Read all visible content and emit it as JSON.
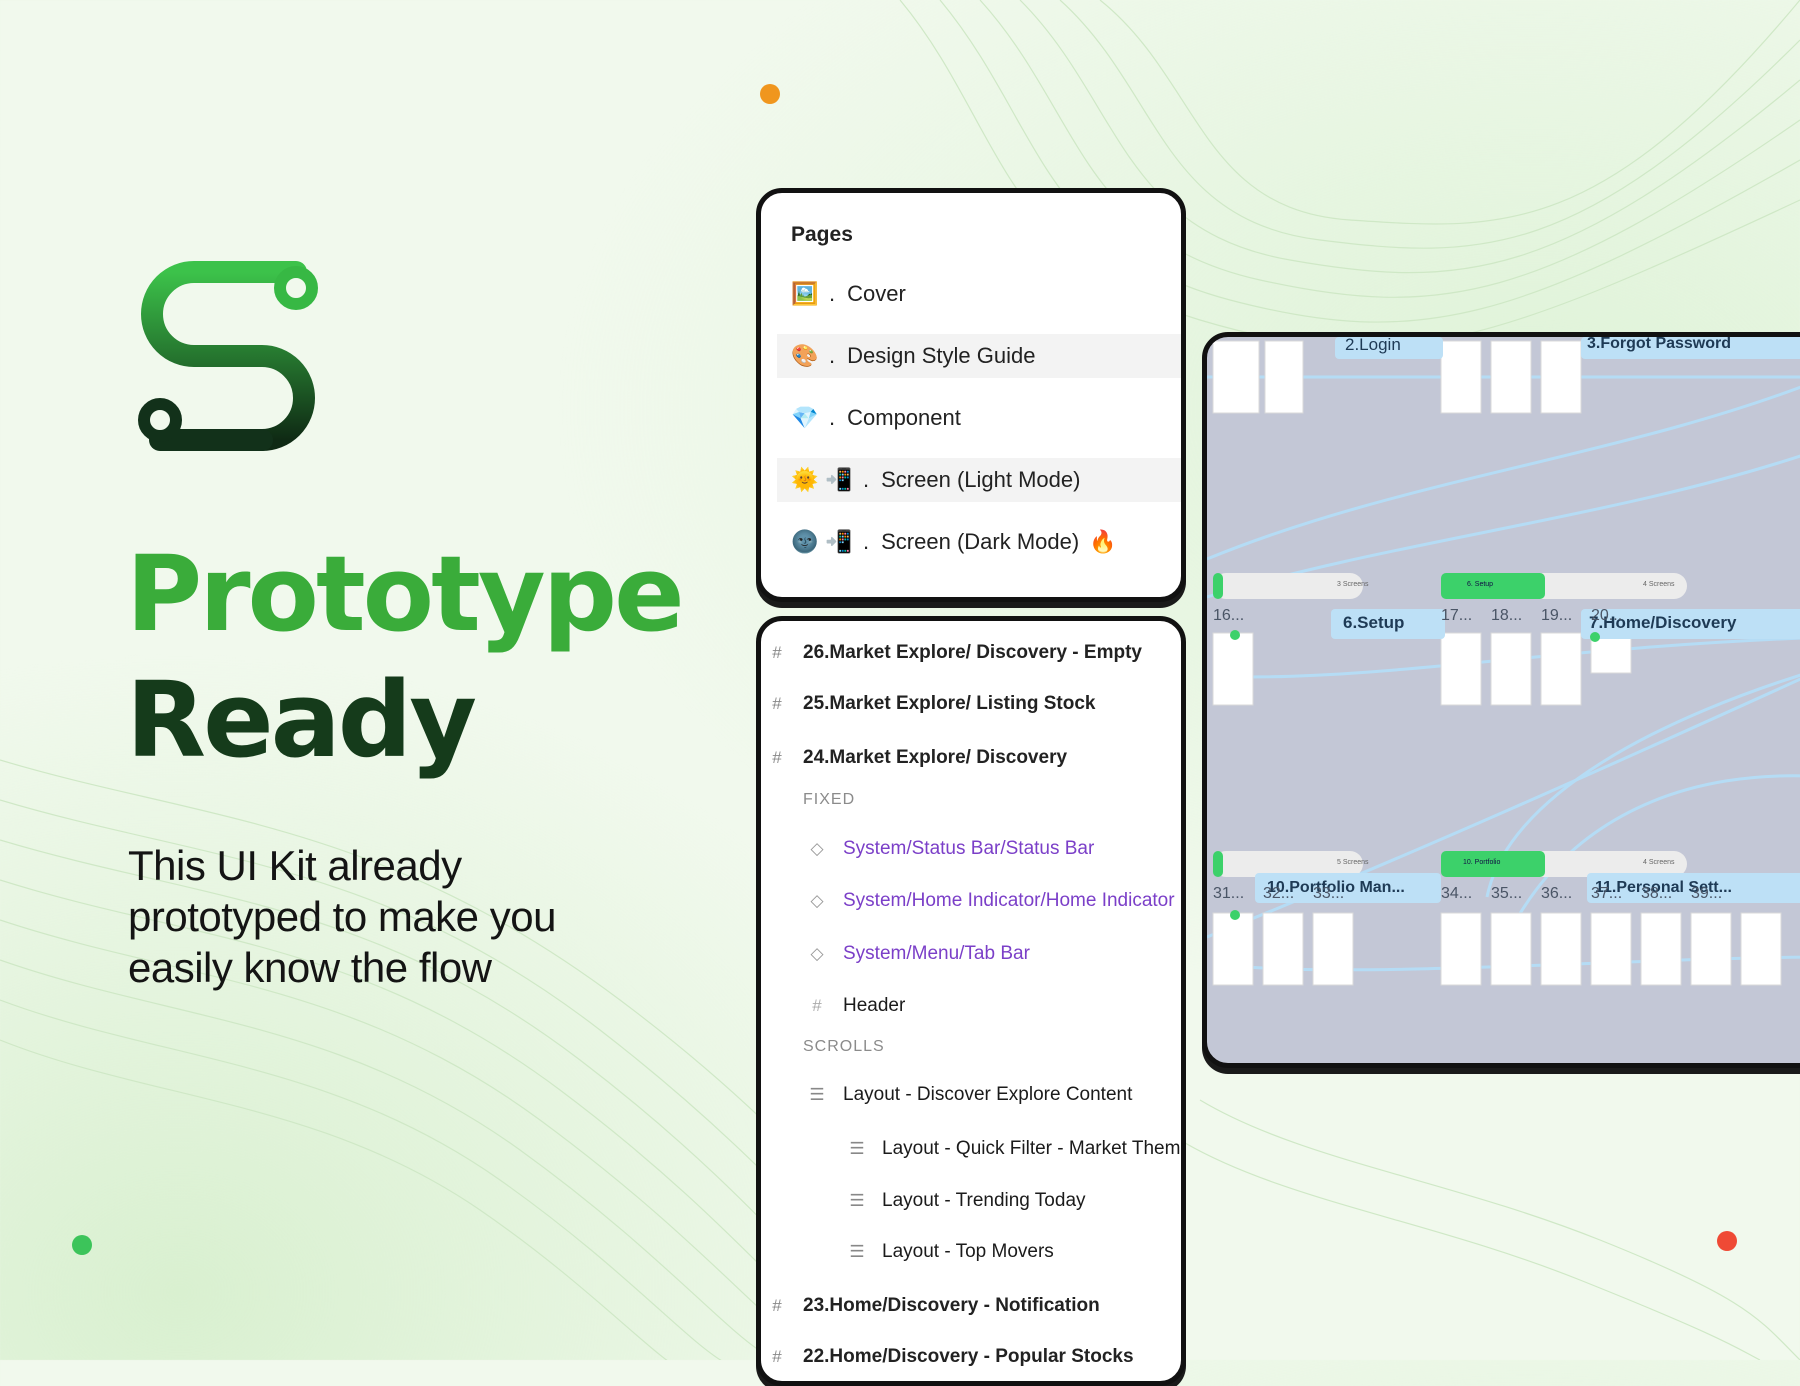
{
  "headline": {
    "line1": "Prototype",
    "line2": "Ready"
  },
  "tagline": {
    "line1": "This UI Kit already",
    "line2": "prototyped to make you",
    "line3": "easily know the flow"
  },
  "colors": {
    "brand_green": "#3aac3a",
    "dark_green": "#153b1b",
    "orange_dot": "#f0961e",
    "green_dot": "#3cc45a",
    "red_dot": "#ef4a35"
  },
  "pages_panel": {
    "title": "Pages",
    "items": [
      {
        "icon": "framed-picture-icon",
        "glyph": "🖼️",
        "label": "Cover"
      },
      {
        "icon": "palette-icon",
        "glyph": "🎨",
        "label": "Design Style Guide"
      },
      {
        "icon": "gem-icon",
        "glyph": "💎",
        "label": "Component"
      },
      {
        "icon": "sun-face-icon",
        "glyph": "🌞",
        "glyph2": "📲",
        "label": "Screen (Light Mode)"
      },
      {
        "icon": "moon-face-icon",
        "glyph": "🌚",
        "glyph2": "📲",
        "label": "Screen (Dark Mode)",
        "suffix": "🔥"
      }
    ]
  },
  "layers_panel": {
    "rows": [
      {
        "kind": "frame",
        "label": "26.Market Explore/ Discovery - Empty"
      },
      {
        "kind": "frame",
        "label": "25.Market Explore/ Listing Stock"
      },
      {
        "kind": "frame",
        "label": "24.Market Explore/ Discovery"
      },
      {
        "kind": "section",
        "label": "FIXED"
      },
      {
        "kind": "instance",
        "label": "System/Status Bar/Status Bar"
      },
      {
        "kind": "instance",
        "label": "System/Home Indicator/Home Indicator"
      },
      {
        "kind": "instance",
        "label": "System/Menu/Tab Bar"
      },
      {
        "kind": "subframe",
        "label": "Header"
      },
      {
        "kind": "section",
        "label": "SCROLLS"
      },
      {
        "kind": "layout",
        "label": "Layout - Discover Explore Content"
      },
      {
        "kind": "layout2",
        "label": "Layout - Quick Filter - Market Theme"
      },
      {
        "kind": "layout2",
        "label": "Layout - Trending Today"
      },
      {
        "kind": "layout2",
        "label": "Layout - Top Movers"
      },
      {
        "kind": "frame",
        "label": "23.Home/Discovery - Notification"
      },
      {
        "kind": "frame",
        "label": "22.Home/Discovery - Popular Stocks"
      }
    ]
  },
  "flow_canvas": {
    "labels": {
      "login": "2.Login",
      "forgot": "3.Forgot Password",
      "setup": "6.Setup",
      "home": "7.Home/Discovery",
      "portfolio": "10.Portfolio Man...",
      "personal": "11.Personal Sett..."
    },
    "bars": {
      "screens_a": "3 Screens",
      "setup_tag": "6. Setup",
      "screens_b": "4 Screens",
      "screens_c": "5 Screens",
      "tag_c": "10. Portfolio",
      "screens_d": "4 Screens"
    },
    "row1_numbers": [
      "16...",
      "17...",
      "18...",
      "19...",
      "20..."
    ],
    "row2_numbers": [
      "31...",
      "32...",
      "33...",
      "34...",
      "35...",
      "36...",
      "37...",
      "38...",
      "39..."
    ]
  }
}
